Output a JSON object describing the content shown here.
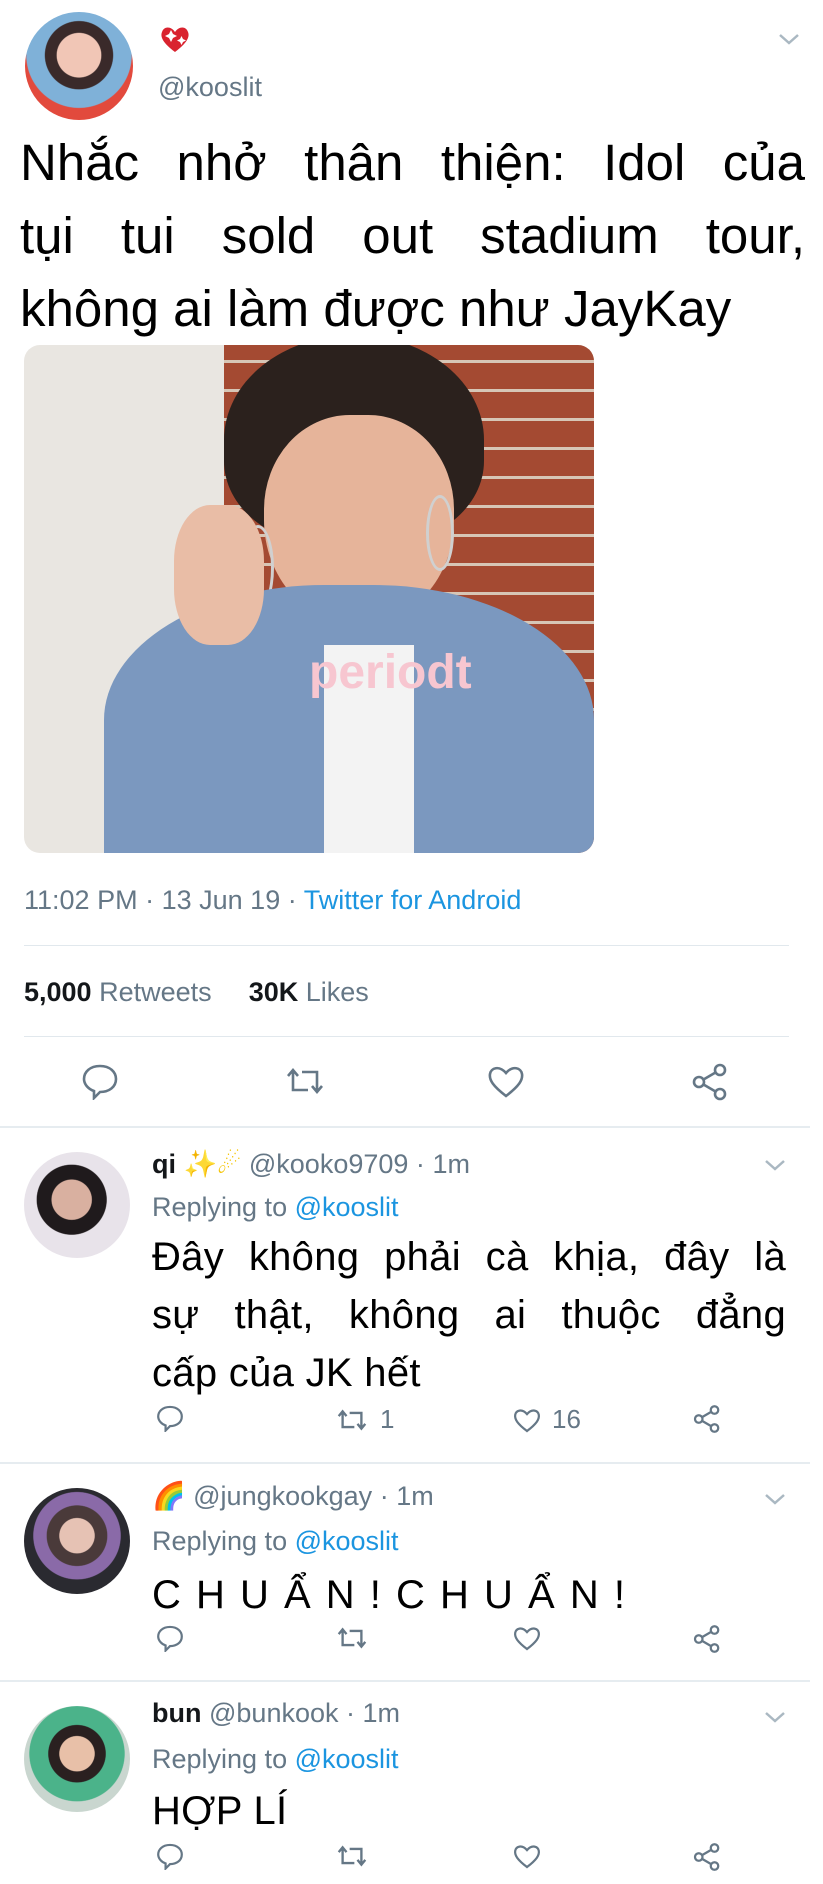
{
  "tweet": {
    "handle": "@kooslit",
    "name_emoji": "heart-sparkle-emoji",
    "text_lines": [
      "Nhắc nhở thân thiện: Idol của",
      "tụi tui sold out stadium tour,",
      "không ai làm được như JayKay"
    ],
    "image_caption": "periodt",
    "time": "11:02 PM",
    "date": "13 Jun 19",
    "source": "Twitter for Android",
    "sep": "·",
    "retweet_count": "5,000",
    "retweet_label": "Retweets",
    "like_count": "30K",
    "like_label": "Likes"
  },
  "replies": [
    {
      "name": "qi",
      "handle": "@kooko9709",
      "time": "1m",
      "replying_prefix": "Replying to",
      "replying_to": "@kooslit",
      "text_lines": [
        "Đây không phải cà khịa, đây là",
        "sự thật, không ai thuộc đẳng",
        "cấp của JK hết"
      ],
      "retweets": "1",
      "likes": "16"
    },
    {
      "name": "",
      "handle": "@jungkookgay",
      "time": "1m",
      "replying_prefix": "Replying to",
      "replying_to": "@kooslit",
      "text_lines": [
        "C H U Ẩ N ! C H U Ẩ N !"
      ],
      "retweets": "",
      "likes": ""
    },
    {
      "name": "bun",
      "handle": "@bunkook",
      "time": "1m",
      "replying_prefix": "Replying to",
      "replying_to": "@kooslit",
      "text_lines": [
        "HỢP LÍ"
      ],
      "retweets": "",
      "likes": ""
    }
  ],
  "colors": {
    "link": "#1b95e0",
    "muted": "#657786",
    "divider": "#e1e8ed"
  }
}
